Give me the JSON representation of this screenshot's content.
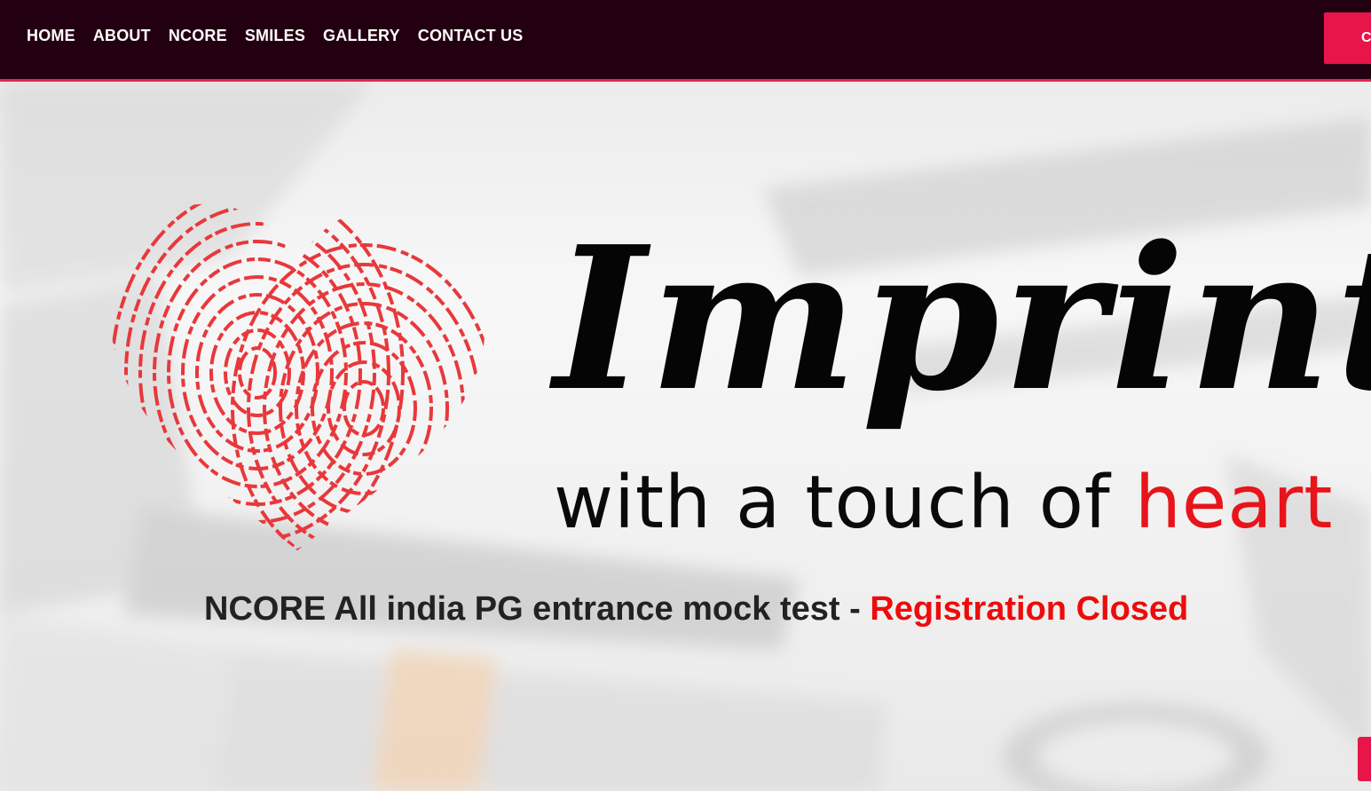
{
  "nav": {
    "items": [
      {
        "label": "HOME"
      },
      {
        "label": "ABOUT"
      },
      {
        "label": "NCORE"
      },
      {
        "label": "SMILES"
      },
      {
        "label": "GALLERY"
      },
      {
        "label": "CONTACT US"
      }
    ],
    "cta_label": "C"
  },
  "logo": {
    "word": "Imprints",
    "tagline_main": "with a touch of ",
    "tagline_accent": "heart"
  },
  "hero": {
    "headline_main": "NCORE All india PG entrance mock test - ",
    "headline_status": "Registration Closed"
  },
  "colors": {
    "nav_bg": "#230011",
    "accent": "#e8154a",
    "heart_red": "#e8383b",
    "status_red": "#ee0b0b"
  }
}
